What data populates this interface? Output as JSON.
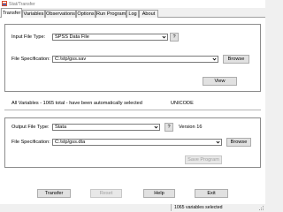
{
  "window": {
    "title": "Stat/Transfer"
  },
  "tabs": [
    {
      "label": "Transfer"
    },
    {
      "label": "Variables"
    },
    {
      "label": "Observations"
    },
    {
      "label": "Options"
    },
    {
      "label": "Run Program"
    },
    {
      "label": "Log"
    },
    {
      "label": "About"
    }
  ],
  "input": {
    "file_type_label": "Input File Type:",
    "file_type_value": "SPSS Data File",
    "help_label": "?",
    "file_spec_label": "File Specification:",
    "file_spec_value": "C:/stp/gss.sav",
    "browse_label": "Browse",
    "view_label": "View"
  },
  "variables_status": {
    "text": "All Variables - 1065 total - have been automatically selected",
    "encoding": "UNICODE"
  },
  "output": {
    "file_type_label": "Output File Type:",
    "file_type_value": "Stata",
    "help_label": "?",
    "version": "Version 16",
    "file_spec_label": "File Specification:",
    "file_spec_value": "C:/stp/gss.dta",
    "browse_label": "Browse",
    "save_program_label": "Save Program"
  },
  "buttons": {
    "transfer": "Transfer",
    "reset": "Reset",
    "help": "Help",
    "exit": "Exit"
  },
  "statusbar": {
    "text": "1065 variables selected"
  },
  "icons": {
    "app": "stat-transfer-app-icon",
    "dropdown": "chevron-down-icon",
    "grip": "resize-grip-icon"
  }
}
